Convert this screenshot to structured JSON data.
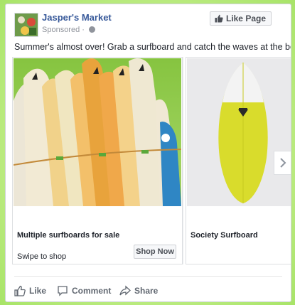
{
  "post": {
    "page_name": "Jasper's Market",
    "sponsored": "Sponsored",
    "like_page_label": "Like Page",
    "message": "Summer's almost over! Grab a surfboard and catch the waves at the beach."
  },
  "carousel": {
    "cards": [
      {
        "title": "Multiple surfboards for sale",
        "subtitle": "Swipe to shop",
        "cta": "Shop Now"
      },
      {
        "title": "Society Surfboard"
      }
    ]
  },
  "actions": {
    "like": "Like",
    "comment": "Comment",
    "share": "Share"
  },
  "colors": {
    "link": "#365899",
    "meta": "#90949c",
    "page_bg": "#c9ef9a"
  },
  "icons": [
    "globe-icon",
    "thumbs-up-icon",
    "chevron-right-icon",
    "comment-icon",
    "share-icon"
  ]
}
